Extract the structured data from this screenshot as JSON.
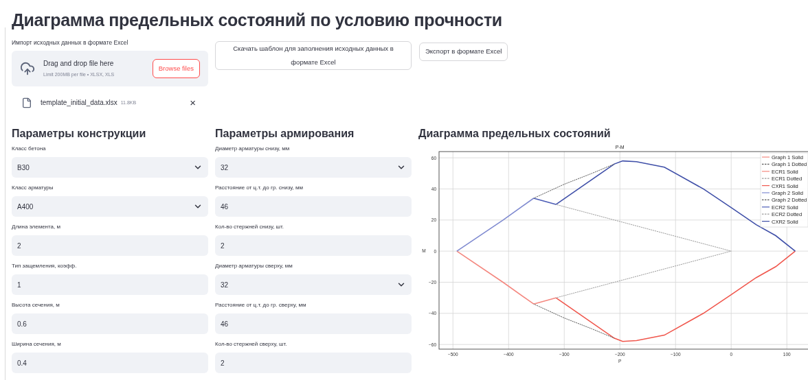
{
  "title": "Диаграмма предельных состояний по условию прочности",
  "uploader": {
    "label": "Импорт исходных данных в формате Excel",
    "drop_text": "Drag and drop file here",
    "limit_text": "Limit 200MB per file • XLSX, XLS",
    "browse_button": "Browse files",
    "file": {
      "name": "template_initial_data.xlsx",
      "size": "11.8KB",
      "remove": "×"
    }
  },
  "buttons": [
    "Скачать шаблон для заполнения исходных данных в формате Excel",
    "Экспорт в формате Excel"
  ],
  "sections": [
    {
      "heading": "Параметры конструкции",
      "fields": [
        {
          "label": "Класс бетона",
          "value": "B30",
          "kind": "select"
        },
        {
          "label": "Класс арматуры",
          "value": "A400",
          "kind": "select"
        },
        {
          "label": "Длина элемента, м",
          "value": "2",
          "kind": "number"
        },
        {
          "label": "Тип защемления, коэфф.",
          "value": "1",
          "kind": "number"
        },
        {
          "label": "Высота сечения, м",
          "value": "0.6",
          "kind": "number"
        },
        {
          "label": "Ширина сечения, м",
          "value": "0.4",
          "kind": "number"
        }
      ]
    },
    {
      "heading": "Параметры армирования",
      "fields": [
        {
          "label": "Диаметр арматуры снизу, мм",
          "value": "32",
          "kind": "select"
        },
        {
          "label": "Расстояние от ц.т. до гр. снизу, мм",
          "value": "46",
          "kind": "number"
        },
        {
          "label": "Кол-во стержней снизу, шт.",
          "value": "2",
          "kind": "number"
        },
        {
          "label": "Диаметр арматуры сверху, мм",
          "value": "32",
          "kind": "select"
        },
        {
          "label": "Расстояние от ц.т. до гр. сверху, мм",
          "value": "46",
          "kind": "number"
        },
        {
          "label": "Кол-во стержней сверху, шт.",
          "value": "2",
          "kind": "number"
        }
      ]
    }
  ],
  "diagram": {
    "heading": "Диаграмма предельных состояний",
    "chart_data": {
      "type": "line",
      "title": "P-M",
      "xlabel": "P",
      "ylabel": "M",
      "xlim": [
        -525,
        138
      ],
      "ylim": [
        -63,
        64
      ],
      "xticks": [
        -500,
        -400,
        -300,
        -200,
        -100,
        0,
        100
      ],
      "yticks": [
        -60,
        -40,
        -20,
        0,
        20,
        40,
        60
      ],
      "grid": true,
      "legend": true,
      "series": [
        {
          "name": "Graph 1 Solid",
          "color": "#f4877f",
          "line_style": "solid",
          "x": [
            -493,
            -410,
            -355
          ],
          "values": [
            0,
            -20,
            -34
          ]
        },
        {
          "name": "Graph 1 Dotted",
          "color": "#555555",
          "line_style": "dashed",
          "x": [
            -355,
            -300,
            -250,
            -210
          ],
          "values": [
            -34,
            -43,
            -50,
            -56
          ]
        },
        {
          "name": "ECR1 Solid",
          "color": "#f4877f",
          "line_style": "solid",
          "x": [
            -355,
            -315
          ],
          "values": [
            -34,
            -30
          ]
        },
        {
          "name": "ECR1 Dotted",
          "color": "#999999",
          "line_style": "dashed",
          "x": [
            -315,
            0
          ],
          "values": [
            -30,
            0
          ]
        },
        {
          "name": "CXR1 Solid",
          "color": "#f0564c",
          "line_style": "solid",
          "x": [
            -315,
            -210,
            -195,
            -170,
            -120,
            -50,
            0,
            45,
            80,
            115
          ],
          "values": [
            -30,
            -56,
            -58,
            -57.5,
            -54,
            -40,
            -28,
            -17,
            -10,
            0
          ]
        },
        {
          "name": "Graph 2 Solid",
          "color": "#7f8ad0",
          "line_style": "solid",
          "x": [
            -493,
            -410,
            -355
          ],
          "values": [
            0,
            20,
            34
          ]
        },
        {
          "name": "Graph 2 Dotted",
          "color": "#555555",
          "line_style": "dashed",
          "x": [
            -355,
            -300,
            -250,
            -210
          ],
          "values": [
            34,
            43,
            50,
            56
          ]
        },
        {
          "name": "ECR2 Solid",
          "color": "#4a5bb5",
          "line_style": "solid",
          "x": [
            -355,
            -315
          ],
          "values": [
            34,
            30
          ]
        },
        {
          "name": "ECR2 Dotted",
          "color": "#999999",
          "line_style": "dashed",
          "x": [
            -315,
            0
          ],
          "values": [
            30,
            0
          ]
        },
        {
          "name": "CXR2 Solid",
          "color": "#3f4fa8",
          "line_style": "solid",
          "x": [
            -315,
            -210,
            -195,
            -170,
            -120,
            -50,
            0,
            45,
            80,
            115
          ],
          "values": [
            30,
            56,
            58,
            57.5,
            54,
            40,
            28,
            17,
            10,
            0
          ]
        }
      ]
    }
  }
}
